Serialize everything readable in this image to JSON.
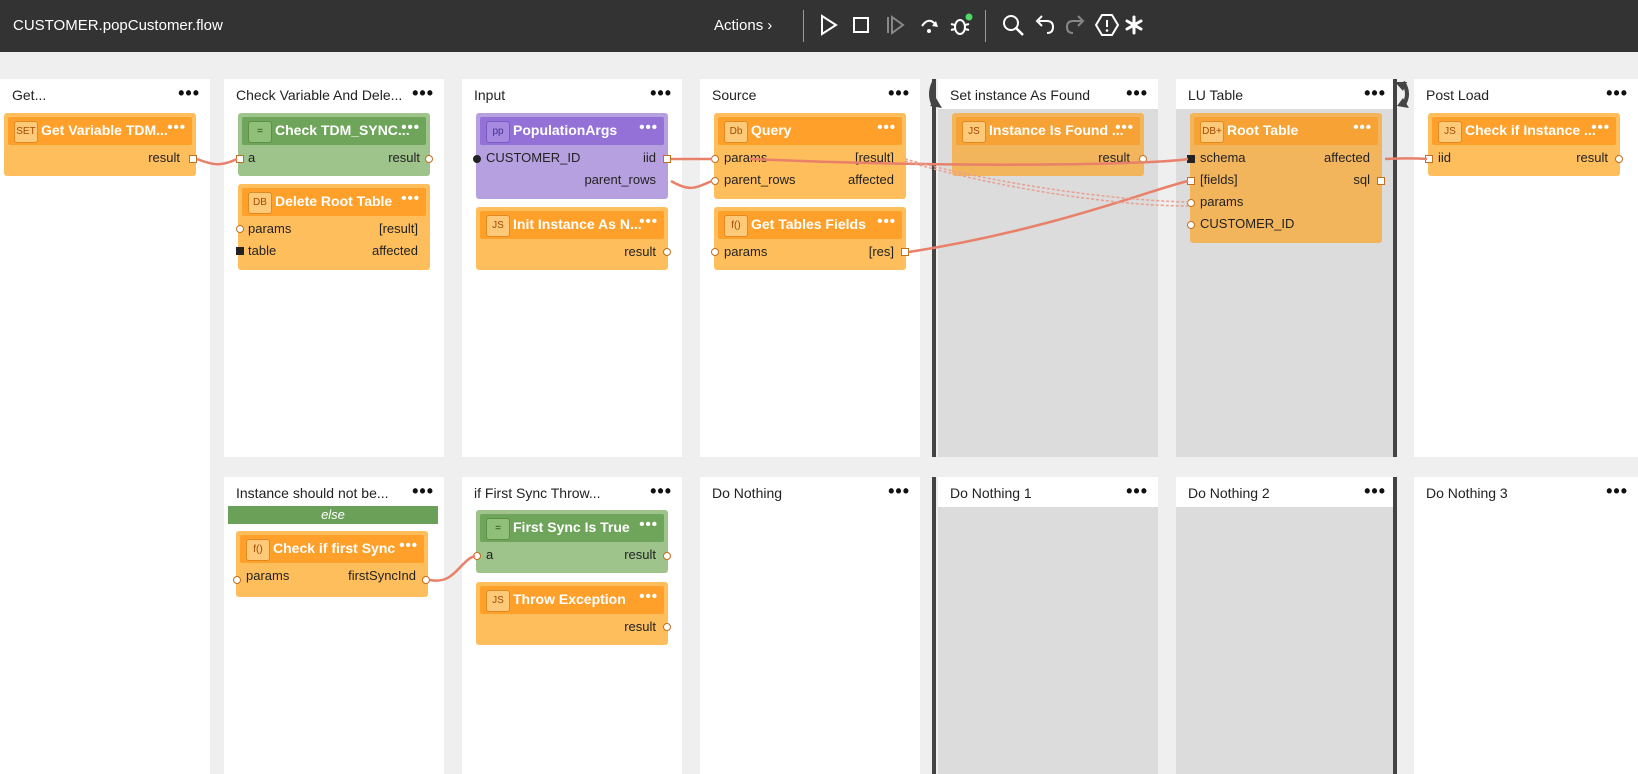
{
  "window": {
    "title": "CUSTOMER.popCustomer.flow"
  },
  "toolbar": {
    "actions_label": "Actions",
    "actions_chevron": "›",
    "icons": [
      "play-icon",
      "stop-icon",
      "step-icon",
      "step-over-icon",
      "debug-icon",
      "search-icon",
      "undo-icon",
      "redo-icon",
      "warning-icon",
      "asterisk-icon"
    ],
    "debug_status_color": "#4cd964"
  },
  "colors": {
    "orange_head": "#ffa02a",
    "orange_body": "#ffbe5c",
    "green_head": "#6ea55a",
    "purple_head": "#9371d7",
    "wire": "#e9806a"
  },
  "stages_top": [
    {
      "title": "Get..."
    },
    {
      "title": "Check Variable And Dele..."
    },
    {
      "title": "Input"
    },
    {
      "title": "Source"
    },
    {
      "title": "Set instance As Found"
    },
    {
      "title": "LU Table"
    },
    {
      "title": "Post Load"
    }
  ],
  "stages_bottom": [
    {
      "title": "Instance should not be..."
    },
    {
      "title": "if First Sync Throw..."
    },
    {
      "title": "Do Nothing"
    },
    {
      "title": "Do Nothing 1"
    },
    {
      "title": "Do Nothing 2"
    },
    {
      "title": "Do Nothing 3"
    }
  ],
  "else_label": "else",
  "nodes": {
    "get_variable": {
      "badge": "SET",
      "title": "Get Variable TDM...",
      "ports": {
        "out1": "result"
      }
    },
    "check_tdm": {
      "badge": "=",
      "title": "Check TDM_SYNC...",
      "ports": {
        "in1": "a",
        "out1": "result"
      }
    },
    "delete_root": {
      "badge": "DB",
      "title": "Delete Root Table",
      "ports": {
        "in1": "params",
        "in2": "table",
        "out1": "[result]",
        "out2": "affected"
      }
    },
    "population_args": {
      "badge": "pp",
      "title": "PopulationArgs",
      "ports": {
        "in1": "CUSTOMER_ID",
        "out1": "iid",
        "out2": "parent_rows"
      }
    },
    "init_instance": {
      "badge": "JS",
      "title": "Init Instance As N...",
      "ports": {
        "out1": "result"
      }
    },
    "query": {
      "badge": "Db",
      "title": "Query",
      "ports": {
        "in1": "params",
        "in2": "parent_rows",
        "out1": "[result]",
        "out2": "affected"
      }
    },
    "get_tables_fields": {
      "badge": "f()",
      "title": "Get Tables Fields",
      "ports": {
        "in1": "params",
        "out1": "[res]"
      }
    },
    "instance_found": {
      "badge": "JS",
      "title": "Instance Is Found ...",
      "ports": {
        "out1": "result"
      }
    },
    "root_table": {
      "badge": "DB+",
      "title": "Root Table",
      "ports": {
        "in1": "schema",
        "in2": "[fields]",
        "in3": "params",
        "in4": "CUSTOMER_ID",
        "out1": "affected",
        "out2": "sql"
      }
    },
    "check_if_instance": {
      "badge": "JS",
      "title": "Check if Instance ...",
      "ports": {
        "in1": "iid",
        "out1": "result"
      }
    },
    "check_first_sync": {
      "badge": "f()",
      "title": "Check if first Sync",
      "ports": {
        "in1": "params",
        "out1": "firstSyncInd"
      }
    },
    "first_sync_true": {
      "badge": "=",
      "title": "First Sync Is True",
      "ports": {
        "in1": "a",
        "out1": "result"
      }
    },
    "throw_exception": {
      "badge": "JS",
      "title": "Throw Exception",
      "ports": {
        "out1": "result"
      }
    }
  },
  "menu_dots": "•••"
}
